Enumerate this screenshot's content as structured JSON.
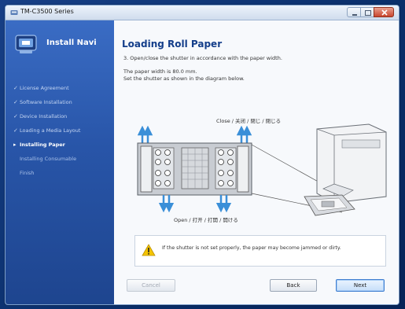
{
  "window": {
    "title": "TM-C3500 Series"
  },
  "sidebar": {
    "brand": "Install Navi",
    "steps": [
      {
        "label": "License Agreement",
        "state": "done",
        "marker": "✓"
      },
      {
        "label": "Software Installation",
        "state": "done",
        "marker": "✓"
      },
      {
        "label": "Device Installation",
        "state": "done",
        "marker": "✓"
      },
      {
        "label": "Loading a Media Layout",
        "state": "done",
        "marker": "✓"
      },
      {
        "label": "Installing Paper",
        "state": "current",
        "marker": "▸"
      },
      {
        "label": "Installing Consumable",
        "state": "upcoming",
        "marker": ""
      },
      {
        "label": "Finish",
        "state": "upcoming",
        "marker": ""
      }
    ]
  },
  "main": {
    "heading": "Loading Roll Paper",
    "instruction": "3. Open/close the shutter in accordance with the paper width.",
    "note_line1": "The paper width is 80.0 mm.",
    "note_line2": "Set the shutter as shown in the diagram below."
  },
  "diagram": {
    "close_label": "Close / 关闭 / 閉じ / 閉じる",
    "open_label": "Open / 打开 / 打開 / 開ける"
  },
  "warning": {
    "icon": "warning-icon",
    "text": "If the shutter is not set properly, the paper may become jammed or dirty."
  },
  "buttons": {
    "cancel": "Cancel",
    "back": "Back",
    "next": "Next"
  },
  "colors": {
    "sidebar": "#2855a8",
    "heading": "#143e8a",
    "arrows": "#3a8fd8",
    "diagram_fill": "#c8ccd2"
  }
}
